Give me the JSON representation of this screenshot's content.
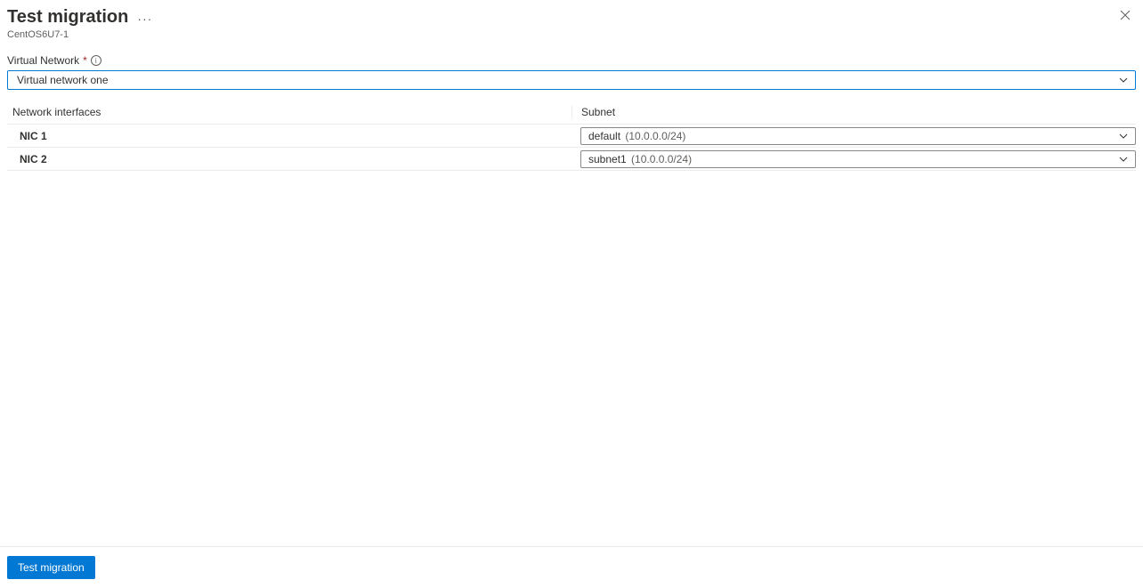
{
  "header": {
    "title": "Test migration",
    "subtitle": "CentOS6U7-1"
  },
  "virtual_network": {
    "label": "Virtual Network",
    "value": "Virtual network one"
  },
  "table": {
    "col_nic": "Network interfaces",
    "col_subnet": "Subnet",
    "rows": [
      {
        "nic": "NIC 1",
        "subnet_name": "default",
        "subnet_cidr": "(10.0.0.0/24)"
      },
      {
        "nic": "NIC 2",
        "subnet_name": "subnet1",
        "subnet_cidr": "(10.0.0.0/24)"
      }
    ]
  },
  "footer": {
    "primary_button": "Test migration"
  }
}
